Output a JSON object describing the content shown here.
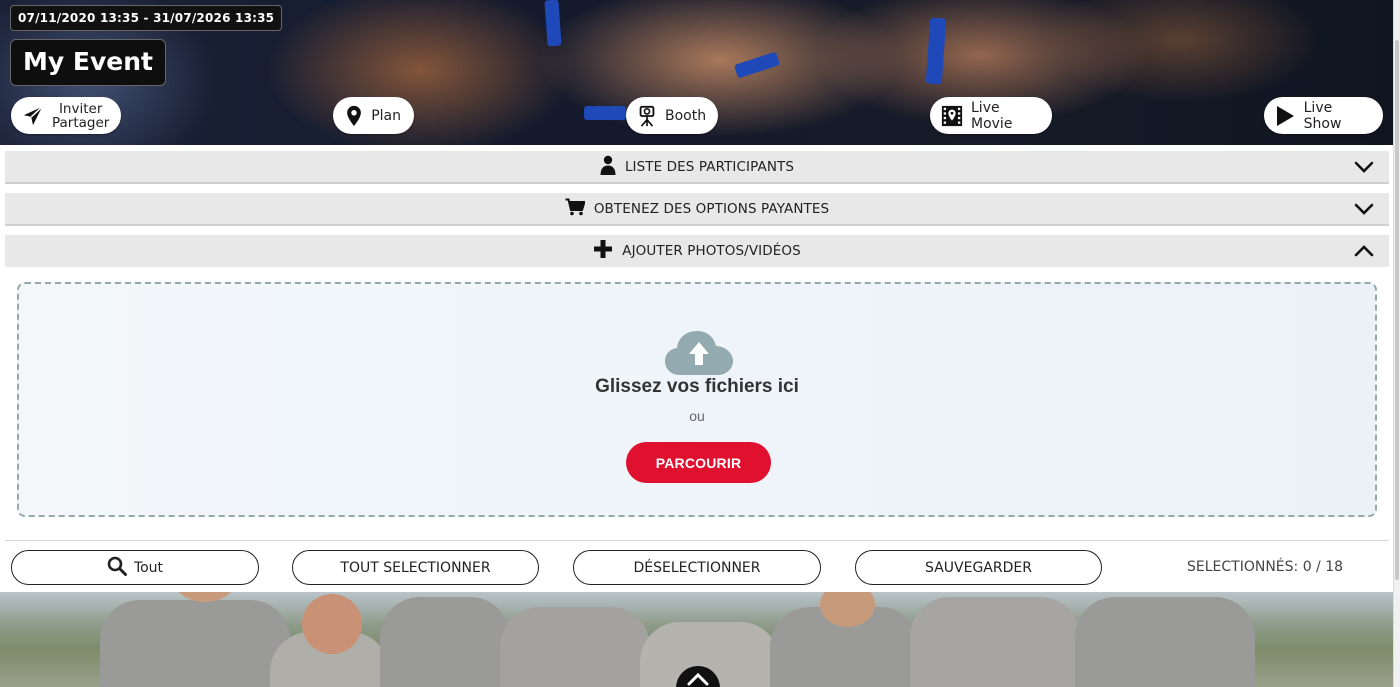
{
  "header": {
    "date_range": "07/11/2020 13:35 - 31/07/2026 13:35",
    "event_title": "My Event",
    "buttons": {
      "invite_line1": "Inviter",
      "invite_line2": "Partager",
      "plan": "Plan",
      "booth": "Booth",
      "live_movie": "Live Movie",
      "live_show": "Live Show"
    }
  },
  "accordions": [
    {
      "label": "LISTE DES PARTICIPANTS",
      "icon": "user-icon",
      "expanded": false
    },
    {
      "label": "OBTENEZ DES OPTIONS PAYANTES",
      "icon": "cart-icon",
      "expanded": false
    },
    {
      "label": "AJOUTER PHOTOS/VIDÉOS",
      "icon": "plus-icon",
      "expanded": true
    }
  ],
  "upload": {
    "title": "Glissez vos fichiers ici",
    "or": "ou",
    "browse": "PARCOURIR"
  },
  "toolbar": {
    "filter": "Tout",
    "select_all": "TOUT SELECTIONNER",
    "deselect": "DÉSELECTIONNER",
    "save": "SAUVEGARDER",
    "selected_count": "SELECTIONNÉS: 0 / 18"
  },
  "colors": {
    "accent_red": "#e0102f",
    "accordion_bg": "#e8e8e8",
    "dropzone_border": "#95a9a9"
  }
}
